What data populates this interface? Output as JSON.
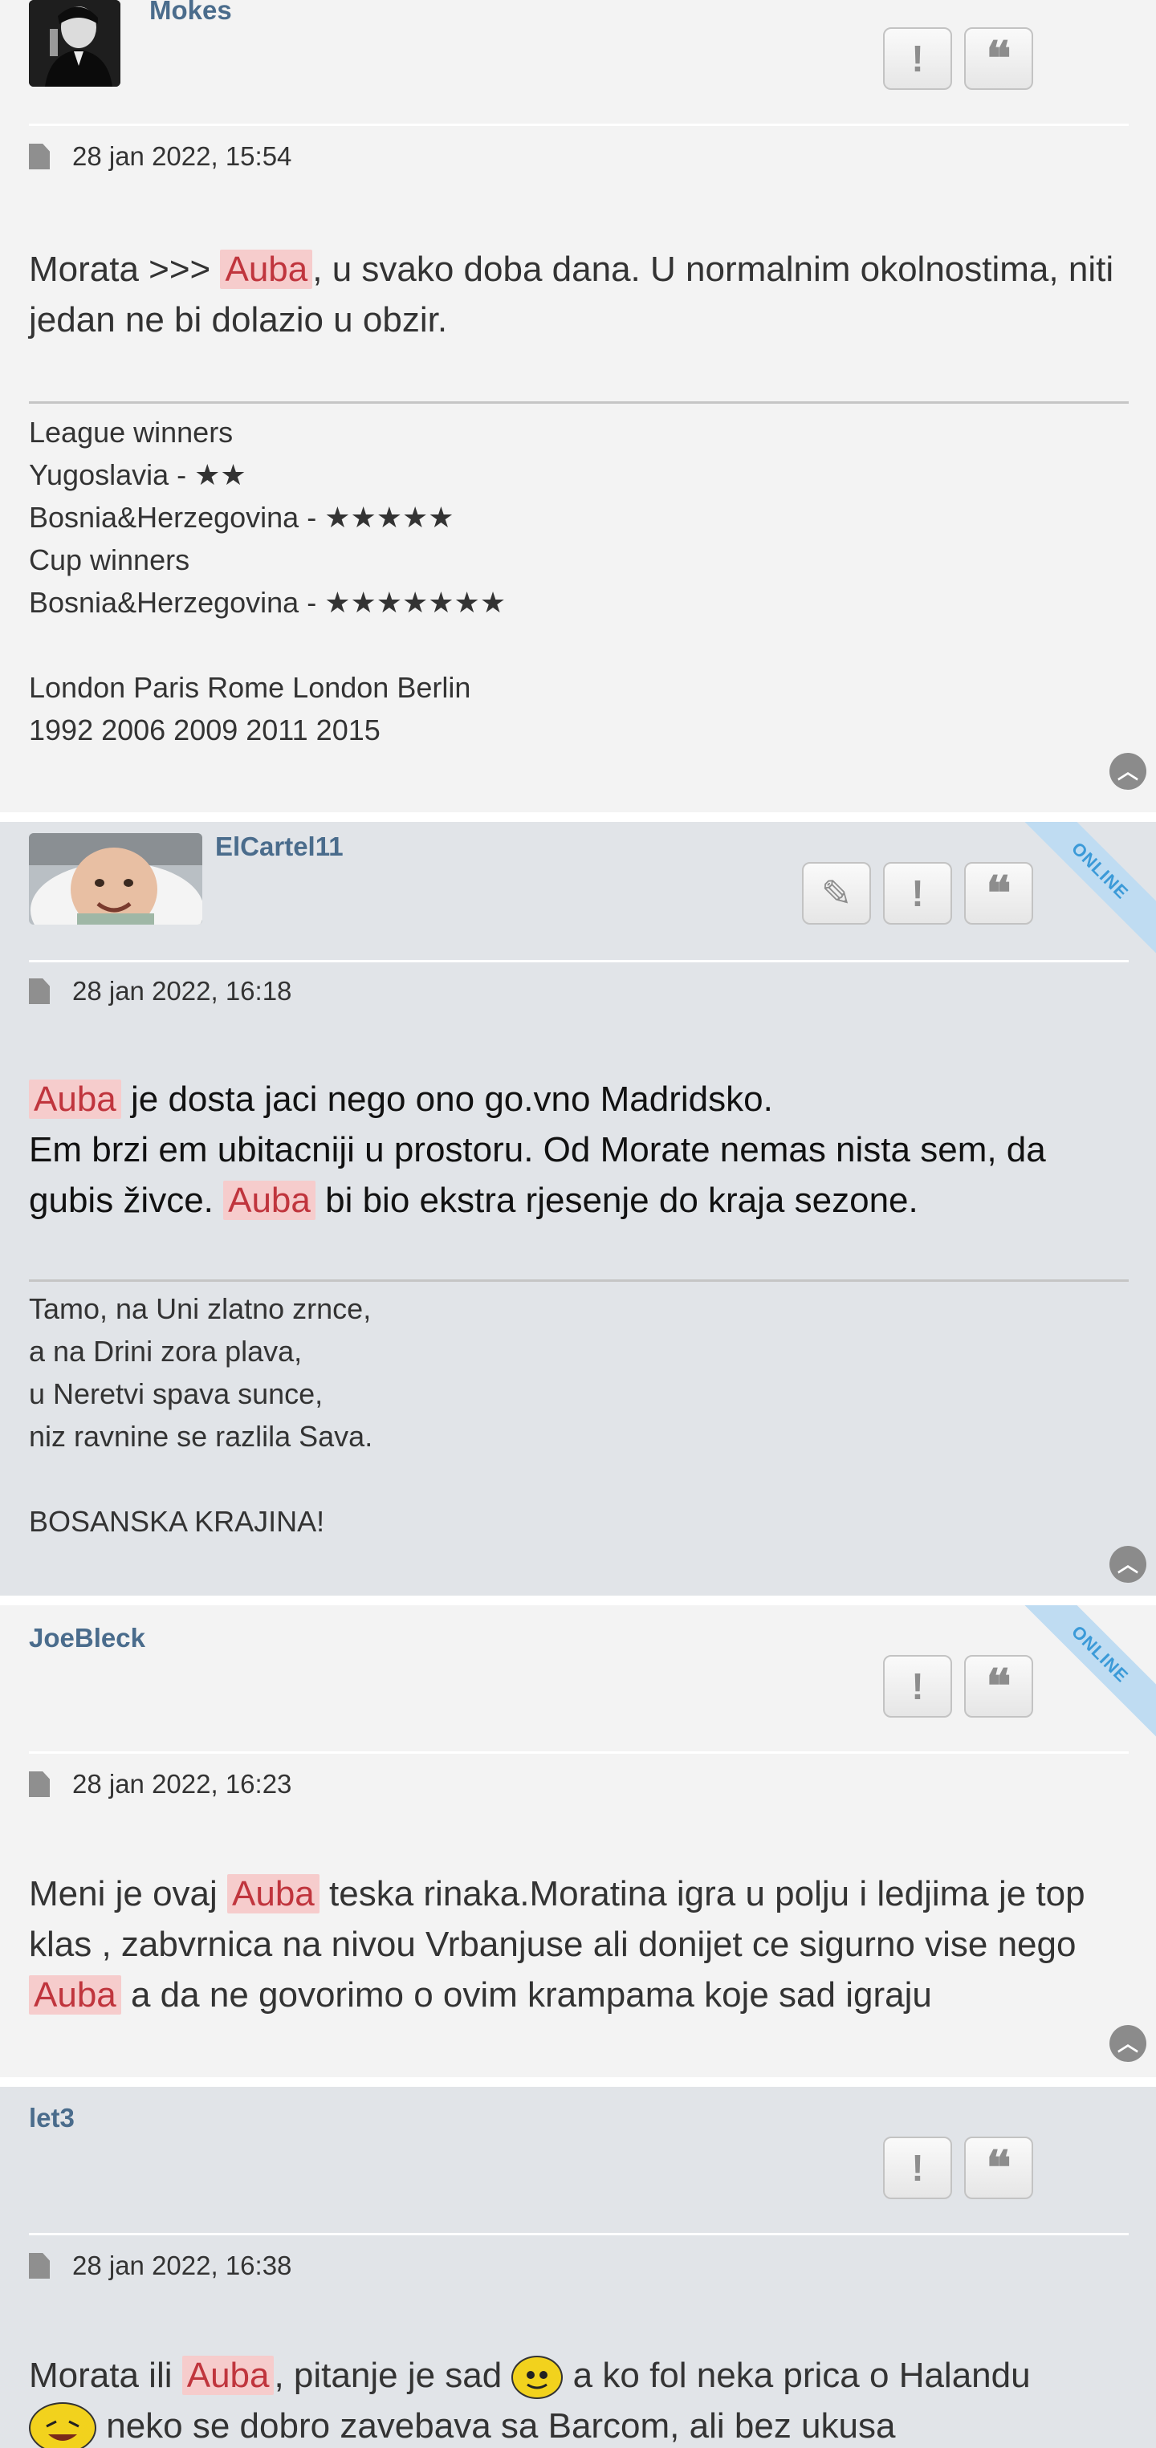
{
  "posts": [
    {
      "username": "Mokes",
      "date": "28 jan 2022, 15:54",
      "content_before": "Morata >>> ",
      "highlight": "Auba",
      "content_after": ", u svako doba dana. U normalnim okolnostima, niti jedan ne bi dolazio u obzir.",
      "signature": [
        "League winners",
        "Yugoslavia - ★★",
        "Bosnia&Herzegovina - ★★★★★",
        "Cup winners",
        "Bosnia&Herzegovina - ★★★★★★★",
        "",
        "London Paris Rome London Berlin",
        "1992 2006 2009 2011 2015"
      ]
    },
    {
      "username": "ElCartel11",
      "online": "ONLINE",
      "date": "28 jan 2022, 16:18",
      "highlight": "Auba",
      "line1_after": " je dosta jaci nego ono go.vno Madridsko.",
      "line2": "Em brzi em ubitacniji u prostoru. Od Morate nemas nista sem, da gubis živce. ",
      "line2_after": " bi bio ekstra rjesenje do kraja sezone.",
      "signature": [
        "Tamo, na Uni zlatno zrnce,",
        "a na Drini zora plava,",
        "u Neretvi spava sunce,",
        "niz ravnine se razlila Sava.",
        "",
        "BOSANSKA KRAJINA!"
      ]
    },
    {
      "username": "JoeBleck",
      "online": "ONLINE",
      "date": "28 jan 2022, 16:23",
      "before": "Meni je ovaj ",
      "highlight": "Auba",
      "middle": " teska rinaka.Moratina igra u polju i ledjima je top klas , zabvrnica na nivou Vrbanjuse ali donijet ce sigurno vise nego ",
      "after": " a da ne govorimo o ovim krampama koje sad igraju"
    },
    {
      "username": "let3",
      "date": "28 jan 2022, 16:38",
      "before": "Morata ili ",
      "highlight": "Auba",
      "middle": ", pitanje je sad ",
      "after": " a ko fol neka prica o Halandu",
      "line2": " neko se dobro zavebava sa Barcom, ali bez ukusa"
    }
  ],
  "buttons": {
    "report": "!",
    "quote": "❝",
    "edit": "✎",
    "top": "︿"
  }
}
